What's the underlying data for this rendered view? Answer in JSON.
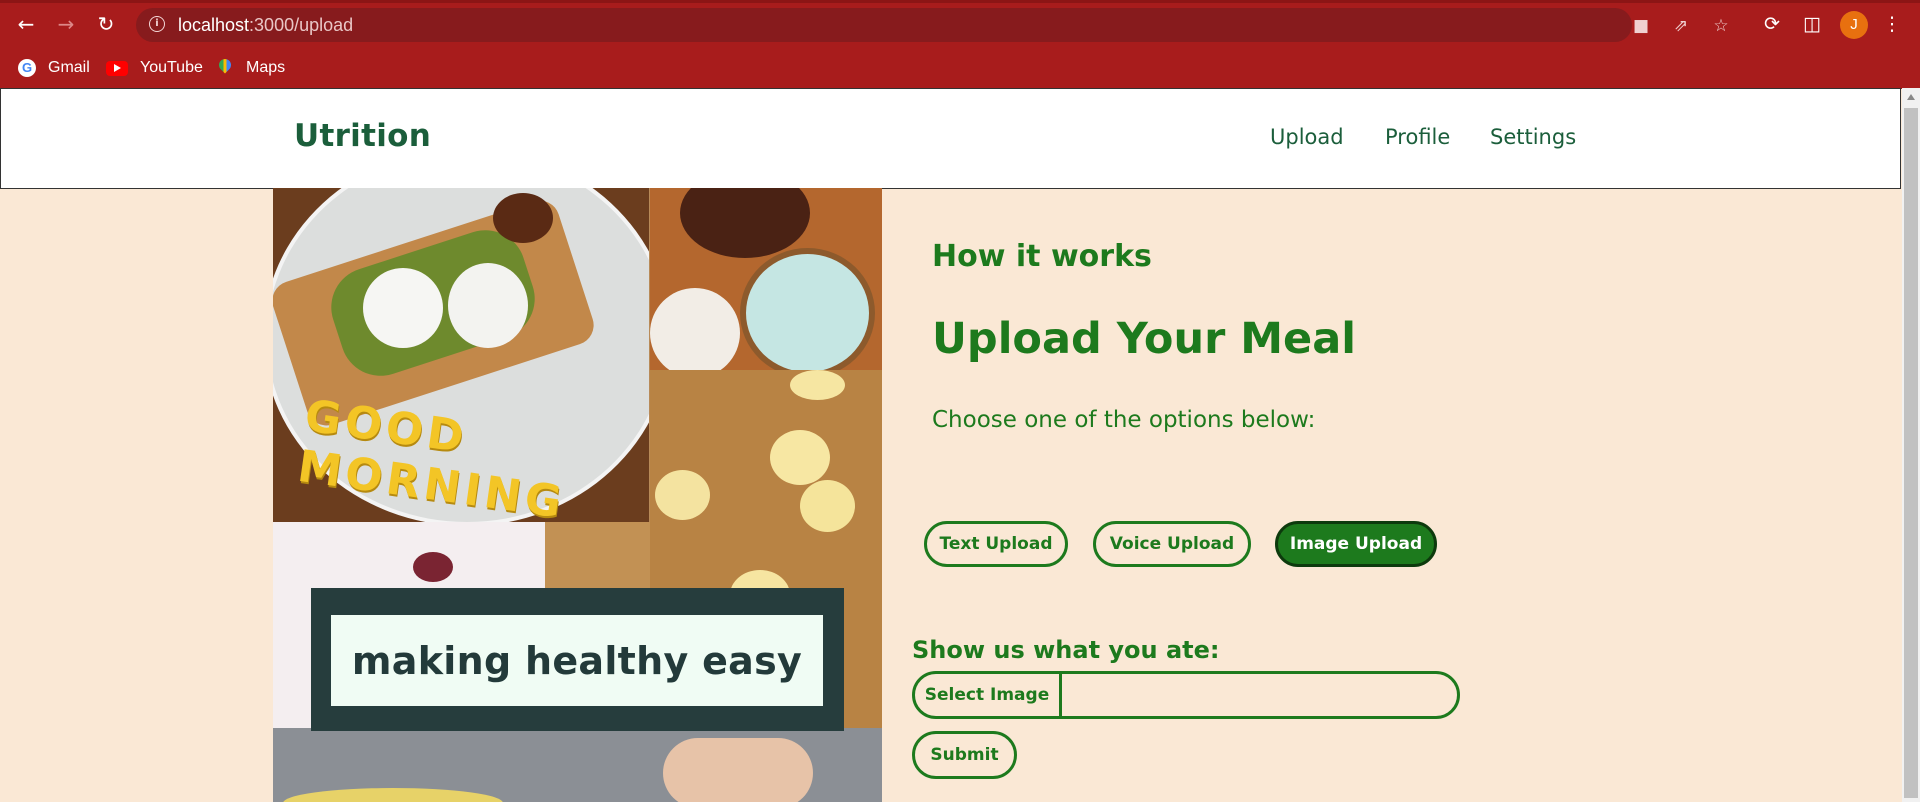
{
  "browser": {
    "url_host": "localhost",
    "url_path": ":3000/upload",
    "profile_initial": "J",
    "bookmarks": [
      {
        "label": "Gmail",
        "icon": "google-icon"
      },
      {
        "label": "YouTube",
        "icon": "youtube-icon"
      },
      {
        "label": "Maps",
        "icon": "maps-icon"
      }
    ]
  },
  "navbar": {
    "brand": "Utrition",
    "links": [
      "Upload",
      "Profile",
      "Settings"
    ]
  },
  "hero": {
    "tagline": "making healthy easy",
    "plate_letters": "GOOD MORNING"
  },
  "main": {
    "section_label": "How it works",
    "title": "Upload Your Meal",
    "instruction": "Choose one of the options below:",
    "options": [
      {
        "label": "Text Upload",
        "active": false
      },
      {
        "label": "Voice Upload",
        "active": false
      },
      {
        "label": "Image Upload",
        "active": true
      }
    ],
    "upload_prompt": "Show us what you ate:",
    "select_button": "Select Image",
    "file_value": "",
    "submit": "Submit"
  },
  "colors": {
    "browser_frame": "#a81c1c",
    "omnibox": "#871b1d",
    "page_bg": "#fae8d5",
    "brand_green": "#1b5e3b",
    "accent_green": "#1d7a1d",
    "tagline_frame": "#263d3d",
    "avatar": "#e8700f"
  }
}
